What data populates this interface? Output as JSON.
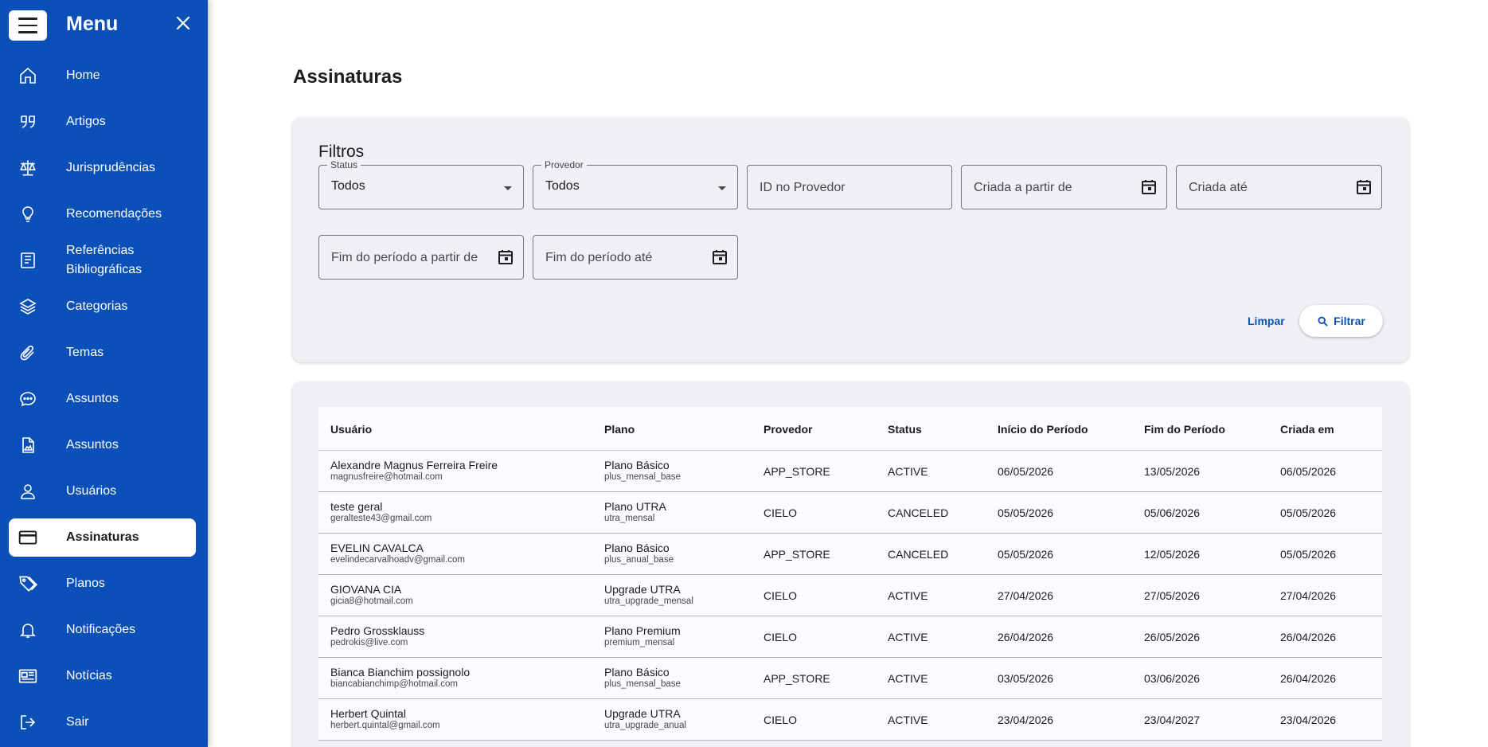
{
  "menu": {
    "title": "Menu",
    "items": [
      {
        "label": "Home",
        "icon": "home-icon"
      },
      {
        "label": "Artigos",
        "icon": "quote-icon"
      },
      {
        "label": "Jurisprudências",
        "icon": "scale-icon"
      },
      {
        "label": "Recomendações",
        "icon": "lightbulb-icon"
      },
      {
        "label": "Referências Bibliográficas",
        "icon": "book-icon"
      },
      {
        "label": "Categorias",
        "icon": "layers-icon"
      },
      {
        "label": "Temas",
        "icon": "paperclip-icon"
      },
      {
        "label": "Assuntos",
        "icon": "chat-icon"
      },
      {
        "label": "Assuntos",
        "icon": "document-image-icon"
      },
      {
        "label": "Usuários",
        "icon": "user-icon"
      },
      {
        "label": "Assinaturas",
        "icon": "credit-card-icon"
      },
      {
        "label": "Planos",
        "icon": "tags-icon"
      },
      {
        "label": "Notificações",
        "icon": "bell-icon"
      },
      {
        "label": "Notícias",
        "icon": "newspaper-icon"
      },
      {
        "label": "Sair",
        "icon": "logout-icon"
      }
    ],
    "active": "Assinaturas"
  },
  "page": {
    "title": "Assinaturas"
  },
  "filters": {
    "title": "Filtros",
    "status": {
      "label": "Status",
      "value": "Todos"
    },
    "provedor": {
      "label": "Provedor",
      "value": "Todos"
    },
    "id_provedor": {
      "placeholder": "ID no Provedor"
    },
    "criada_de": {
      "placeholder": "Criada a partir de"
    },
    "criada_ate": {
      "placeholder": "Criada até"
    },
    "fim_de": {
      "placeholder": "Fim do período a partir de"
    },
    "fim_ate": {
      "placeholder": "Fim do período até"
    },
    "limpar": "Limpar",
    "filtrar": "Filtrar"
  },
  "table": {
    "headers": [
      "Usuário",
      "Plano",
      "Provedor",
      "Status",
      "Início do Período",
      "Fim do Período",
      "Criada em"
    ],
    "rows": [
      {
        "name": "Alexandre Magnus Ferreira Freire",
        "email": "magnusfreire@hotmail.com",
        "plan": "Plano Básico",
        "plan_code": "plus_mensal_base",
        "provider": "APP_STORE",
        "status": "ACTIVE",
        "start": "06/05/2026",
        "end": "13/05/2026",
        "created": "06/05/2026"
      },
      {
        "name": "teste geral",
        "email": "geralteste43@gmail.com",
        "plan": "Plano UTRA",
        "plan_code": "utra_mensal",
        "provider": "CIELO",
        "status": "CANCELED",
        "start": "05/05/2026",
        "end": "05/06/2026",
        "created": "05/05/2026"
      },
      {
        "name": "EVELIN CAVALCA",
        "email": "evelindecarvalhoadv@gmail.com",
        "plan": "Plano Básico",
        "plan_code": "plus_anual_base",
        "provider": "APP_STORE",
        "status": "CANCELED",
        "start": "05/05/2026",
        "end": "12/05/2026",
        "created": "05/05/2026"
      },
      {
        "name": "GIOVANA CIA",
        "email": "gicia8@hotmail.com",
        "plan": "Upgrade UTRA",
        "plan_code": "utra_upgrade_mensal",
        "provider": "CIELO",
        "status": "ACTIVE",
        "start": "27/04/2026",
        "end": "27/05/2026",
        "created": "27/04/2026"
      },
      {
        "name": "Pedro Grossklauss",
        "email": "pedrokis@live.com",
        "plan": "Plano Premium",
        "plan_code": "premium_mensal",
        "provider": "CIELO",
        "status": "ACTIVE",
        "start": "26/04/2026",
        "end": "26/05/2026",
        "created": "26/04/2026"
      },
      {
        "name": "Bianca Bianchim possignolo",
        "email": "biancabianchimp@hotmail.com",
        "plan": "Plano Básico",
        "plan_code": "plus_mensal_base",
        "provider": "APP_STORE",
        "status": "ACTIVE",
        "start": "03/05/2026",
        "end": "03/06/2026",
        "created": "26/04/2026"
      },
      {
        "name": "Herbert Quintal",
        "email": "herbert.quintal@gmail.com",
        "plan": "Upgrade UTRA",
        "plan_code": "utra_upgrade_anual",
        "provider": "CIELO",
        "status": "ACTIVE",
        "start": "23/04/2026",
        "end": "23/04/2027",
        "created": "23/04/2026"
      }
    ]
  },
  "colors": {
    "sidebar": "#0b50b9",
    "accent": "#0b50b9",
    "card": "#f0eff4"
  }
}
